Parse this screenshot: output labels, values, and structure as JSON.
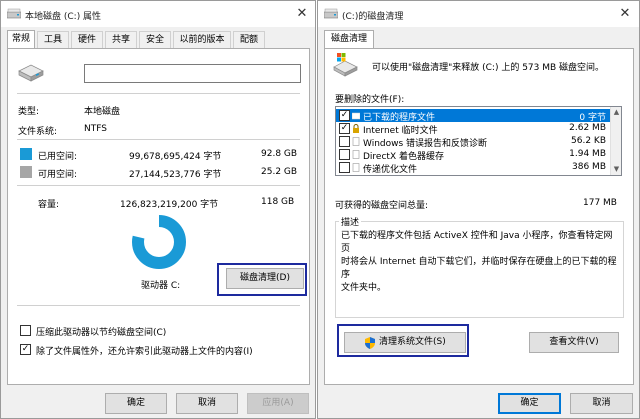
{
  "props": {
    "title": "本地磁盘 (C:) 属性",
    "close_glyph": "✕",
    "tabs": [
      "常规",
      "工具",
      "硬件",
      "共享",
      "安全",
      "以前的版本",
      "配额"
    ],
    "name_value": "",
    "type_label": "类型:",
    "type_value": "本地磁盘",
    "fs_label": "文件系统:",
    "fs_value": "NTFS",
    "used_label": "已用空间:",
    "used_bytes": "99,678,695,424 字节",
    "used_gb": "92.8 GB",
    "free_label": "可用空间:",
    "free_bytes": "27,144,523,776 字节",
    "free_gb": "25.2 GB",
    "capacity_label": "容量:",
    "capacity_bytes": "126,823,219,200 字节",
    "capacity_gb": "118 GB",
    "used_fraction": 0.786,
    "used_color": "#1a9ad6",
    "free_color": "#a6a6a6",
    "drive_label": "驱动器 C:",
    "cleanup_button": "磁盘清理(D)",
    "compress_label": "压缩此驱动器以节约磁盘空间(C)",
    "compress_checked": false,
    "index_label": "除了文件属性外，还允许索引此驱动器上文件的内容(I)",
    "index_checked": true,
    "ok": "确定",
    "cancel": "取消",
    "apply": "应用(A)"
  },
  "cleanup": {
    "title": "(C:)的磁盘清理",
    "close_glyph": "✕",
    "tab": "磁盘清理",
    "intro": "可以使用\"磁盘清理\"来释放  (C:) 上的 573 MB 磁盘空间。",
    "files_label": "要删除的文件(F):",
    "files": [
      {
        "name": "已下载的程序文件",
        "size": "0 字节",
        "checked": true,
        "selected": true,
        "icon": "folder-icon"
      },
      {
        "name": "Internet 临时文件",
        "size": "2.62 MB",
        "checked": true,
        "selected": false,
        "icon": "lock-icon"
      },
      {
        "name": "Windows 错误报告和反馈诊断",
        "size": "56.2 KB",
        "checked": false,
        "selected": false,
        "icon": "file-icon"
      },
      {
        "name": "DirectX 着色器缓存",
        "size": "1.94 MB",
        "checked": false,
        "selected": false,
        "icon": "file-icon"
      },
      {
        "name": "传递优化文件",
        "size": "386 MB",
        "checked": false,
        "selected": false,
        "icon": "file-icon"
      }
    ],
    "gain_label": "可获得的磁盘空间总量:",
    "gain_value": "177 MB",
    "desc_label": "描述",
    "desc_lines": [
      "已下载的程序文件包括 ActiveX 控件和 Java 小程序，你查看特定网页",
      "时将会从 Internet 自动下载它们，并临时保存在硬盘上的已下载的程序",
      "文件夹中。"
    ],
    "system_button": "清理系统文件(S)",
    "view_button": "查看文件(V)",
    "ok": "确定",
    "cancel": "取消",
    "shield_icon": "uac-shield-icon"
  },
  "highlight_color": "#1d2a9e"
}
